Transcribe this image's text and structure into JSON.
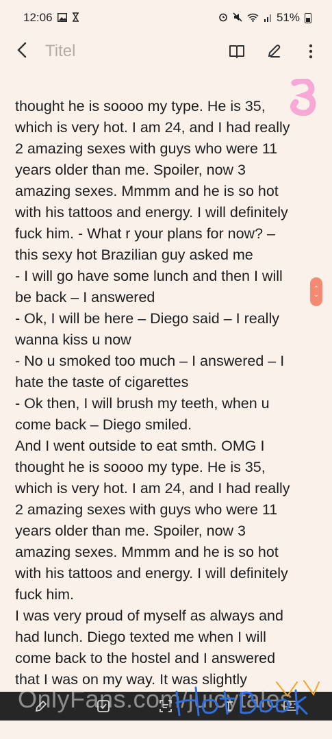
{
  "status": {
    "time": "12:06",
    "battery": "51%",
    "left_icons": [
      "image-icon",
      "hourglass-icon"
    ],
    "right_icons": [
      "alarm-icon",
      "mute-icon",
      "wifi-icon",
      "signal-icon",
      "battery-icon"
    ]
  },
  "header": {
    "title_placeholder": "Titel",
    "toolbar": [
      "book-icon",
      "pen-icon",
      "more-icon"
    ]
  },
  "note": {
    "lines": [
      "thought he is soooo my type. He is 35,",
      "which is very hot. I am 24, and I had really",
      "2 amazing sexes with guys who were 11",
      "years older than me. Spoiler, now 3",
      "amazing sexes. Mmmm and he is so hot",
      "with his tattoos and energy. I will definitely",
      "fuck him. - What r your plans for now? –",
      "this sexy hot Brazilian guy asked me",
      "- I will go have some lunch and then I will",
      "be back – I answered",
      "- Ok, I will be here – Diego said – I really",
      "wanna kiss u now",
      "- No u smoked too much – I answered – I",
      "hate the taste of cigarettes",
      "- Ok then, I will brush my teeth, when u",
      "come back – Diego smiled.",
      "And I went outside to eat smth. OMG I",
      "thought he is soooo my type. He is 35,",
      "which is very hot. I am 24, and I had really",
      "2 amazing sexes with guys who were 11",
      "years older than me. Spoiler, now 3",
      "amazing sexes. Mmmm and he is so hot",
      "with his tattoos and energy. I will definitely",
      "fuck him.",
      "I was very proud of myself as always and",
      "had lunch. Diego texted me when I will",
      "come back to the hostel and I answered",
      "that I was on my way. It was slightly"
    ]
  },
  "bottom_toolbar": [
    "pen-tool-icon",
    "checkbox-icon",
    "scan-text-icon",
    "text-format-icon",
    "keyboard-icon"
  ],
  "watermark": "OnlyFans.com/juicytales",
  "colors": {
    "background": "#faf1ea",
    "accent": "#f48a74",
    "pink_mark": "#f7a9d6",
    "logo_blue": "#2f6fe0",
    "logo_orange": "#f5a623"
  }
}
